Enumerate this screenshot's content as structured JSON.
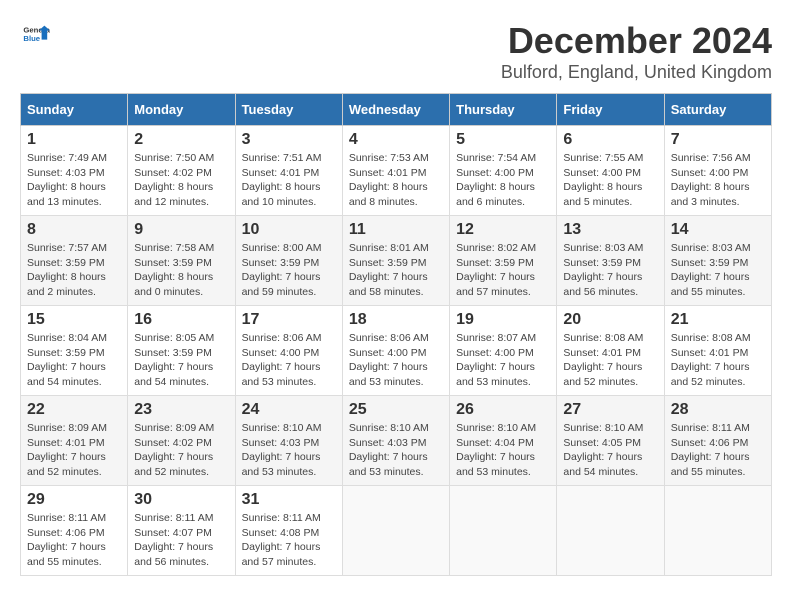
{
  "header": {
    "logo_general": "General",
    "logo_blue": "Blue",
    "title": "December 2024",
    "subtitle": "Bulford, England, United Kingdom"
  },
  "days_of_week": [
    "Sunday",
    "Monday",
    "Tuesday",
    "Wednesday",
    "Thursday",
    "Friday",
    "Saturday"
  ],
  "weeks": [
    [
      {
        "day": "1",
        "info": "Sunrise: 7:49 AM\nSunset: 4:03 PM\nDaylight: 8 hours\nand 13 minutes."
      },
      {
        "day": "2",
        "info": "Sunrise: 7:50 AM\nSunset: 4:02 PM\nDaylight: 8 hours\nand 12 minutes."
      },
      {
        "day": "3",
        "info": "Sunrise: 7:51 AM\nSunset: 4:01 PM\nDaylight: 8 hours\nand 10 minutes."
      },
      {
        "day": "4",
        "info": "Sunrise: 7:53 AM\nSunset: 4:01 PM\nDaylight: 8 hours\nand 8 minutes."
      },
      {
        "day": "5",
        "info": "Sunrise: 7:54 AM\nSunset: 4:00 PM\nDaylight: 8 hours\nand 6 minutes."
      },
      {
        "day": "6",
        "info": "Sunrise: 7:55 AM\nSunset: 4:00 PM\nDaylight: 8 hours\nand 5 minutes."
      },
      {
        "day": "7",
        "info": "Sunrise: 7:56 AM\nSunset: 4:00 PM\nDaylight: 8 hours\nand 3 minutes."
      }
    ],
    [
      {
        "day": "8",
        "info": "Sunrise: 7:57 AM\nSunset: 3:59 PM\nDaylight: 8 hours\nand 2 minutes."
      },
      {
        "day": "9",
        "info": "Sunrise: 7:58 AM\nSunset: 3:59 PM\nDaylight: 8 hours\nand 0 minutes."
      },
      {
        "day": "10",
        "info": "Sunrise: 8:00 AM\nSunset: 3:59 PM\nDaylight: 7 hours\nand 59 minutes."
      },
      {
        "day": "11",
        "info": "Sunrise: 8:01 AM\nSunset: 3:59 PM\nDaylight: 7 hours\nand 58 minutes."
      },
      {
        "day": "12",
        "info": "Sunrise: 8:02 AM\nSunset: 3:59 PM\nDaylight: 7 hours\nand 57 minutes."
      },
      {
        "day": "13",
        "info": "Sunrise: 8:03 AM\nSunset: 3:59 PM\nDaylight: 7 hours\nand 56 minutes."
      },
      {
        "day": "14",
        "info": "Sunrise: 8:03 AM\nSunset: 3:59 PM\nDaylight: 7 hours\nand 55 minutes."
      }
    ],
    [
      {
        "day": "15",
        "info": "Sunrise: 8:04 AM\nSunset: 3:59 PM\nDaylight: 7 hours\nand 54 minutes."
      },
      {
        "day": "16",
        "info": "Sunrise: 8:05 AM\nSunset: 3:59 PM\nDaylight: 7 hours\nand 54 minutes."
      },
      {
        "day": "17",
        "info": "Sunrise: 8:06 AM\nSunset: 4:00 PM\nDaylight: 7 hours\nand 53 minutes."
      },
      {
        "day": "18",
        "info": "Sunrise: 8:06 AM\nSunset: 4:00 PM\nDaylight: 7 hours\nand 53 minutes."
      },
      {
        "day": "19",
        "info": "Sunrise: 8:07 AM\nSunset: 4:00 PM\nDaylight: 7 hours\nand 53 minutes."
      },
      {
        "day": "20",
        "info": "Sunrise: 8:08 AM\nSunset: 4:01 PM\nDaylight: 7 hours\nand 52 minutes."
      },
      {
        "day": "21",
        "info": "Sunrise: 8:08 AM\nSunset: 4:01 PM\nDaylight: 7 hours\nand 52 minutes."
      }
    ],
    [
      {
        "day": "22",
        "info": "Sunrise: 8:09 AM\nSunset: 4:01 PM\nDaylight: 7 hours\nand 52 minutes."
      },
      {
        "day": "23",
        "info": "Sunrise: 8:09 AM\nSunset: 4:02 PM\nDaylight: 7 hours\nand 52 minutes."
      },
      {
        "day": "24",
        "info": "Sunrise: 8:10 AM\nSunset: 4:03 PM\nDaylight: 7 hours\nand 53 minutes."
      },
      {
        "day": "25",
        "info": "Sunrise: 8:10 AM\nSunset: 4:03 PM\nDaylight: 7 hours\nand 53 minutes."
      },
      {
        "day": "26",
        "info": "Sunrise: 8:10 AM\nSunset: 4:04 PM\nDaylight: 7 hours\nand 53 minutes."
      },
      {
        "day": "27",
        "info": "Sunrise: 8:10 AM\nSunset: 4:05 PM\nDaylight: 7 hours\nand 54 minutes."
      },
      {
        "day": "28",
        "info": "Sunrise: 8:11 AM\nSunset: 4:06 PM\nDaylight: 7 hours\nand 55 minutes."
      }
    ],
    [
      {
        "day": "29",
        "info": "Sunrise: 8:11 AM\nSunset: 4:06 PM\nDaylight: 7 hours\nand 55 minutes."
      },
      {
        "day": "30",
        "info": "Sunrise: 8:11 AM\nSunset: 4:07 PM\nDaylight: 7 hours\nand 56 minutes."
      },
      {
        "day": "31",
        "info": "Sunrise: 8:11 AM\nSunset: 4:08 PM\nDaylight: 7 hours\nand 57 minutes."
      },
      null,
      null,
      null,
      null
    ]
  ]
}
